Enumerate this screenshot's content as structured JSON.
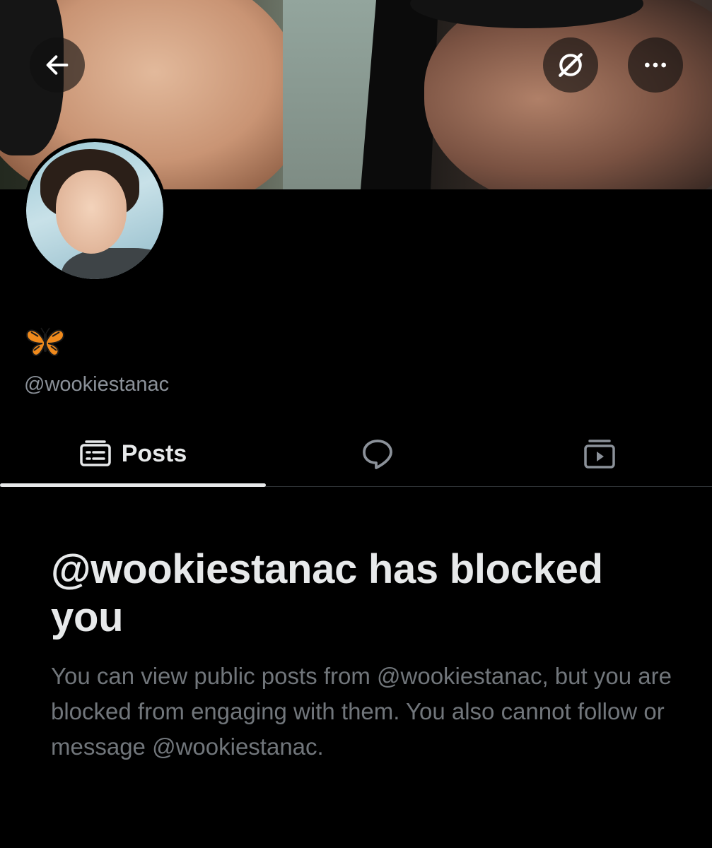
{
  "header": {
    "back_icon": "arrow-left-icon",
    "grok_icon": "grok-icon",
    "more_icon": "more-horizontal-icon"
  },
  "profile": {
    "display_name_emoji": "butterfly-emoji",
    "handle": "@wookiestanac"
  },
  "tabs": [
    {
      "label": "Posts",
      "icon": "posts-icon",
      "selected": true
    },
    {
      "label": "",
      "icon": "reply-bubble-icon",
      "selected": false
    },
    {
      "label": "",
      "icon": "media-play-icon",
      "selected": false
    }
  ],
  "blocked": {
    "title": "@wookiestanac has blocked you",
    "description": "You can view public posts from @wookiestanac, but you are blocked from engaging with them. You also cannot follow or message @wookiestanac."
  },
  "colors": {
    "background": "#000000",
    "primary_text": "#e7e9ea",
    "secondary_text": "#71767b",
    "divider": "#2f3336"
  }
}
